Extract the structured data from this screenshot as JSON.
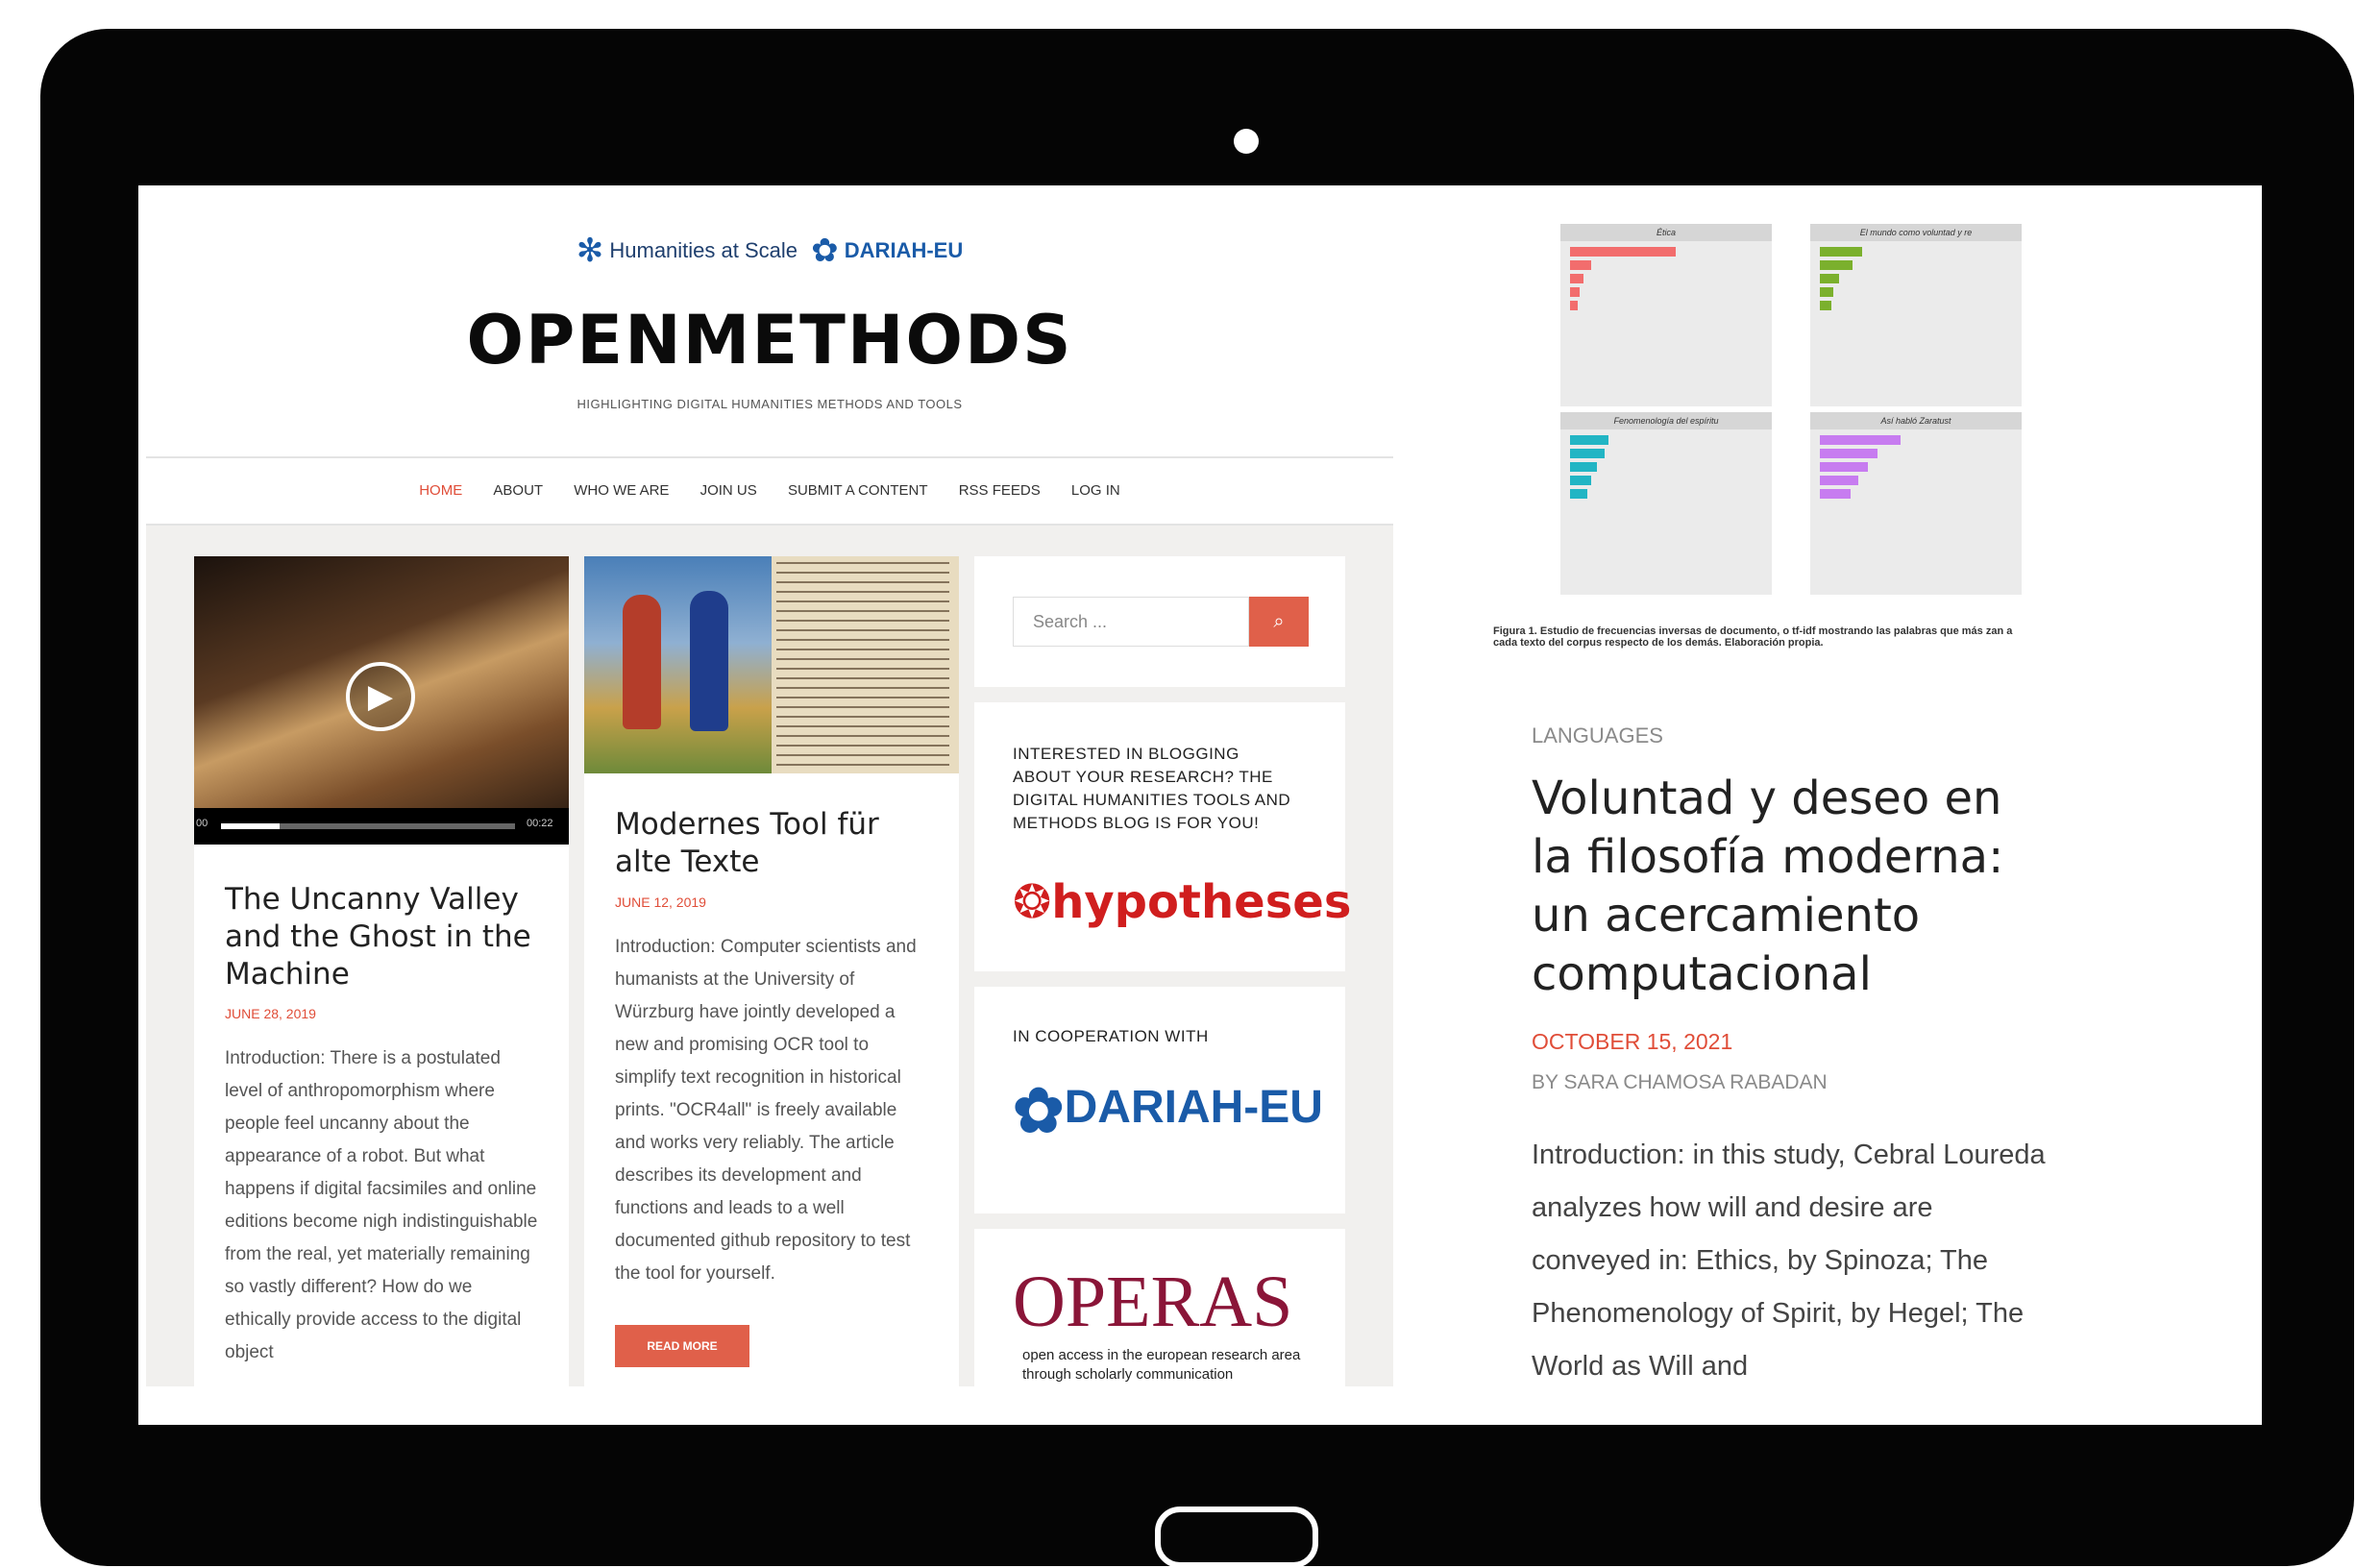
{
  "site": {
    "partner_text": "Humanities at Scale",
    "partner_logo": "DARIAH-EU",
    "title": "OPENMETHODS",
    "tagline": "HIGHLIGHTING DIGITAL HUMANITIES METHODS AND TOOLS"
  },
  "nav": {
    "items": [
      "HOME",
      "ABOUT",
      "WHO WE ARE",
      "JOIN US",
      "SUBMIT A CONTENT",
      "RSS FEEDS",
      "LOG IN"
    ]
  },
  "posts": [
    {
      "title": "The Uncanny Valley and the Ghost in the Machine",
      "date": "JUNE 28, 2019",
      "excerpt": "Introduction: There is a postulated level of anthropomorphism where people feel uncanny about the appearance of a robot. But what happens if digital facsimiles and online editions become nigh indistinguishable from the real, yet materially remaining so vastly different? How do we ethically provide access to the digital object",
      "video_time_start": "00",
      "video_time_end": "00:22"
    },
    {
      "title": "Modernes Tool für alte Texte",
      "date": "JUNE 12, 2019",
      "excerpt": "Introduction: Computer scientists and humanists at the University of Würzburg have jointly developed a new and promising OCR tool to simplify text recognition in historical prints. \"OCR4all\" is freely available and works very reliably. The article describes its development and functions and leads to a well documented github repository to test the tool for yourself.",
      "read_more": "READ MORE"
    }
  ],
  "sidebar": {
    "search_placeholder": "Search ...",
    "hypotheses_text": "INTERESTED IN BLOGGING ABOUT YOUR RESEARCH? THE DIGITAL HUMANITIES TOOLS AND METHODS BLOG IS FOR YOU!",
    "hypotheses_logo": "hypotheses",
    "coop_label": "IN COOPERATION WITH",
    "coop_logo": "DARIAH-EU",
    "operas_logo": "OPERAS",
    "operas_sub": "open access in the european research area through scholarly communication"
  },
  "featured": {
    "figure_caption": "Figura 1. Estudio de frecuencias inversas de documento, o tf-idf mostrando las palabras que más zan a cada texto del corpus respecto de los demás. Elaboración propia.",
    "panels": [
      "Ética",
      "El mundo como voluntad y re",
      "Fenomenología del espíritu",
      "Así habló Zaratust"
    ],
    "category": "LANGUAGES",
    "title": "Voluntad y deseo en la filosofía moderna: un acercamiento computacional",
    "date": "OCTOBER 15, 2021",
    "author": "BY SARA CHAMOSA RABADAN",
    "excerpt": "Introduction: in this study, Cebral Loureda analyzes how will and desire are conveyed in: Ethics, by Spinoza; The Phenomenology of Spirit, by Hegel; The World as Will and"
  },
  "colors": {
    "accent": "#e04d38",
    "dariah_blue": "#1a5ba8",
    "operas_red": "#8a1538",
    "tablet_frame": "#050505"
  }
}
